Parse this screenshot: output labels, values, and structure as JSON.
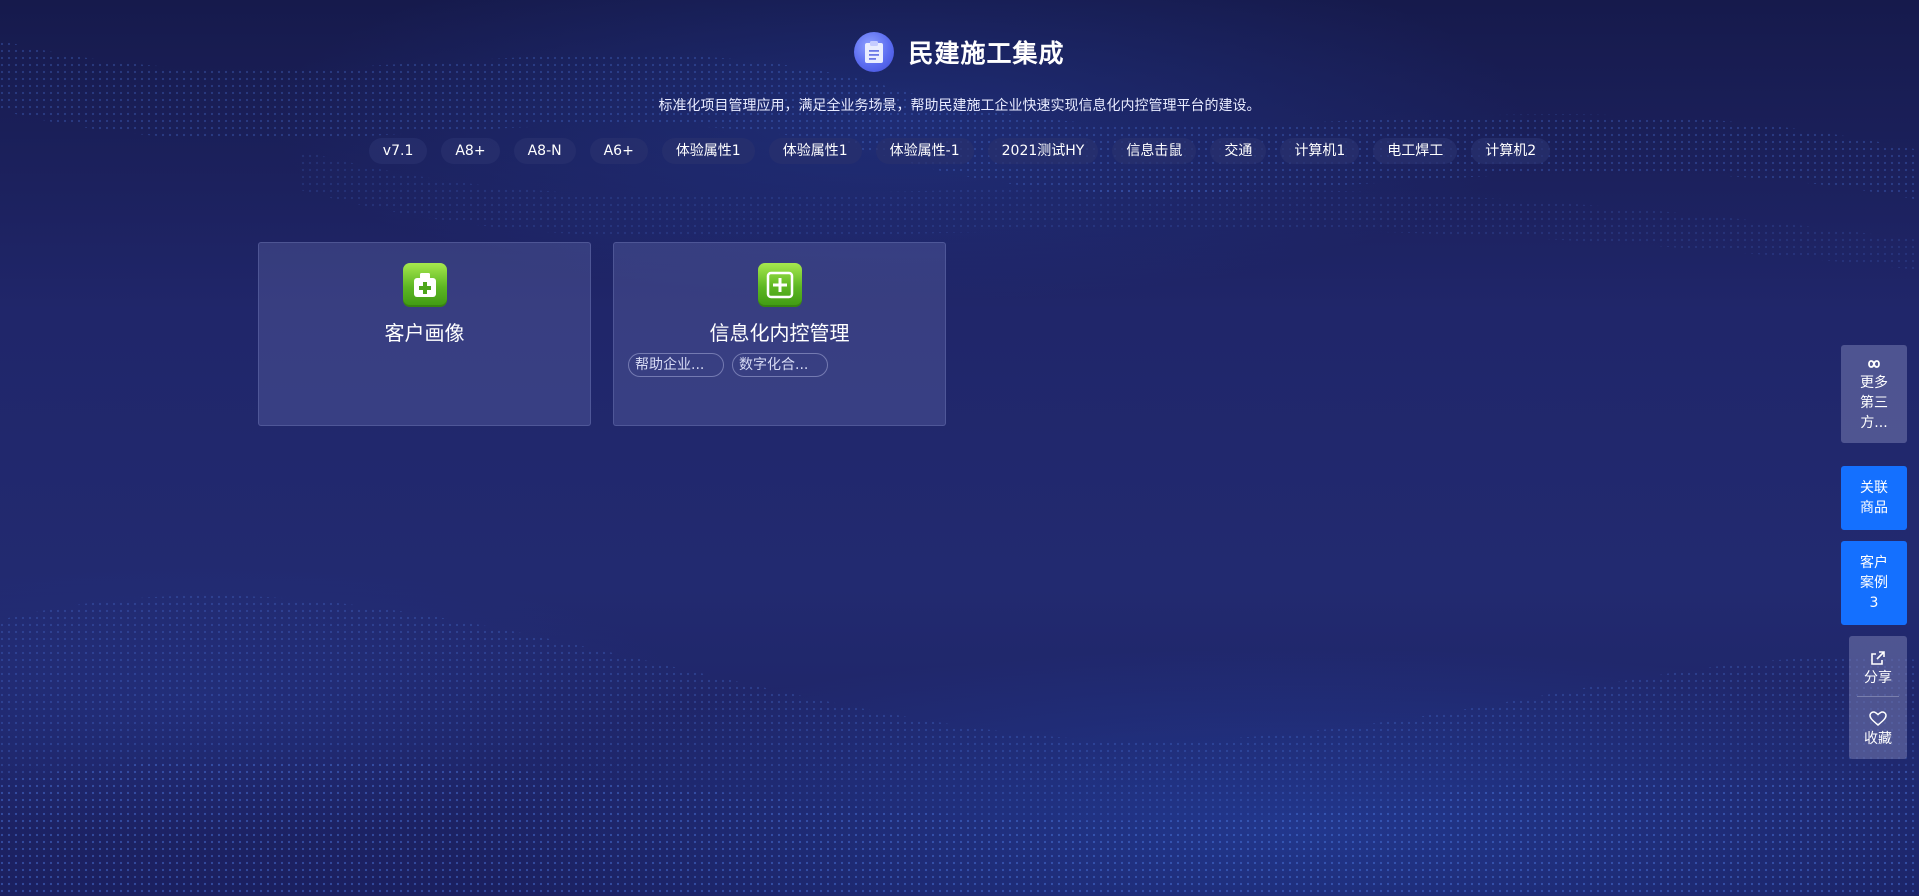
{
  "header": {
    "title": "民建施工集成",
    "logo_icon": "clipboard-icon",
    "subtitle": "标准化项目管理应用，满足全业务场景，帮助民建施工企业快速实现信息化内控管理平台的建设。"
  },
  "tags": [
    "v7.1",
    "A8+",
    "A8-N",
    "A6+",
    "体验属性1",
    "体验属性1",
    "体验属性-1",
    "2021测试HY",
    "信息击鼠",
    "交通",
    "计算机1",
    "电工焊工",
    "计算机2"
  ],
  "cards": [
    {
      "title": "客户画像",
      "icon": "medical-kit-icon",
      "chips": []
    },
    {
      "title": "信息化内控管理",
      "icon": "plus-box-icon",
      "chips": [
        "帮助企业...",
        "数字化合..."
      ]
    }
  ],
  "sidebar": {
    "third_party": {
      "icon": "infinity-icon",
      "label": "更多第三方..."
    },
    "related": {
      "label": "关联商品"
    },
    "cases": {
      "label": "客户案例",
      "count": "3"
    },
    "share": {
      "icon": "share-icon",
      "label": "分享"
    },
    "favorite": {
      "icon": "heart-icon",
      "label": "收藏"
    }
  },
  "colors": {
    "background": "#1e2461",
    "side_blue": "#1470ff",
    "card_icon_green": "#5db622"
  }
}
